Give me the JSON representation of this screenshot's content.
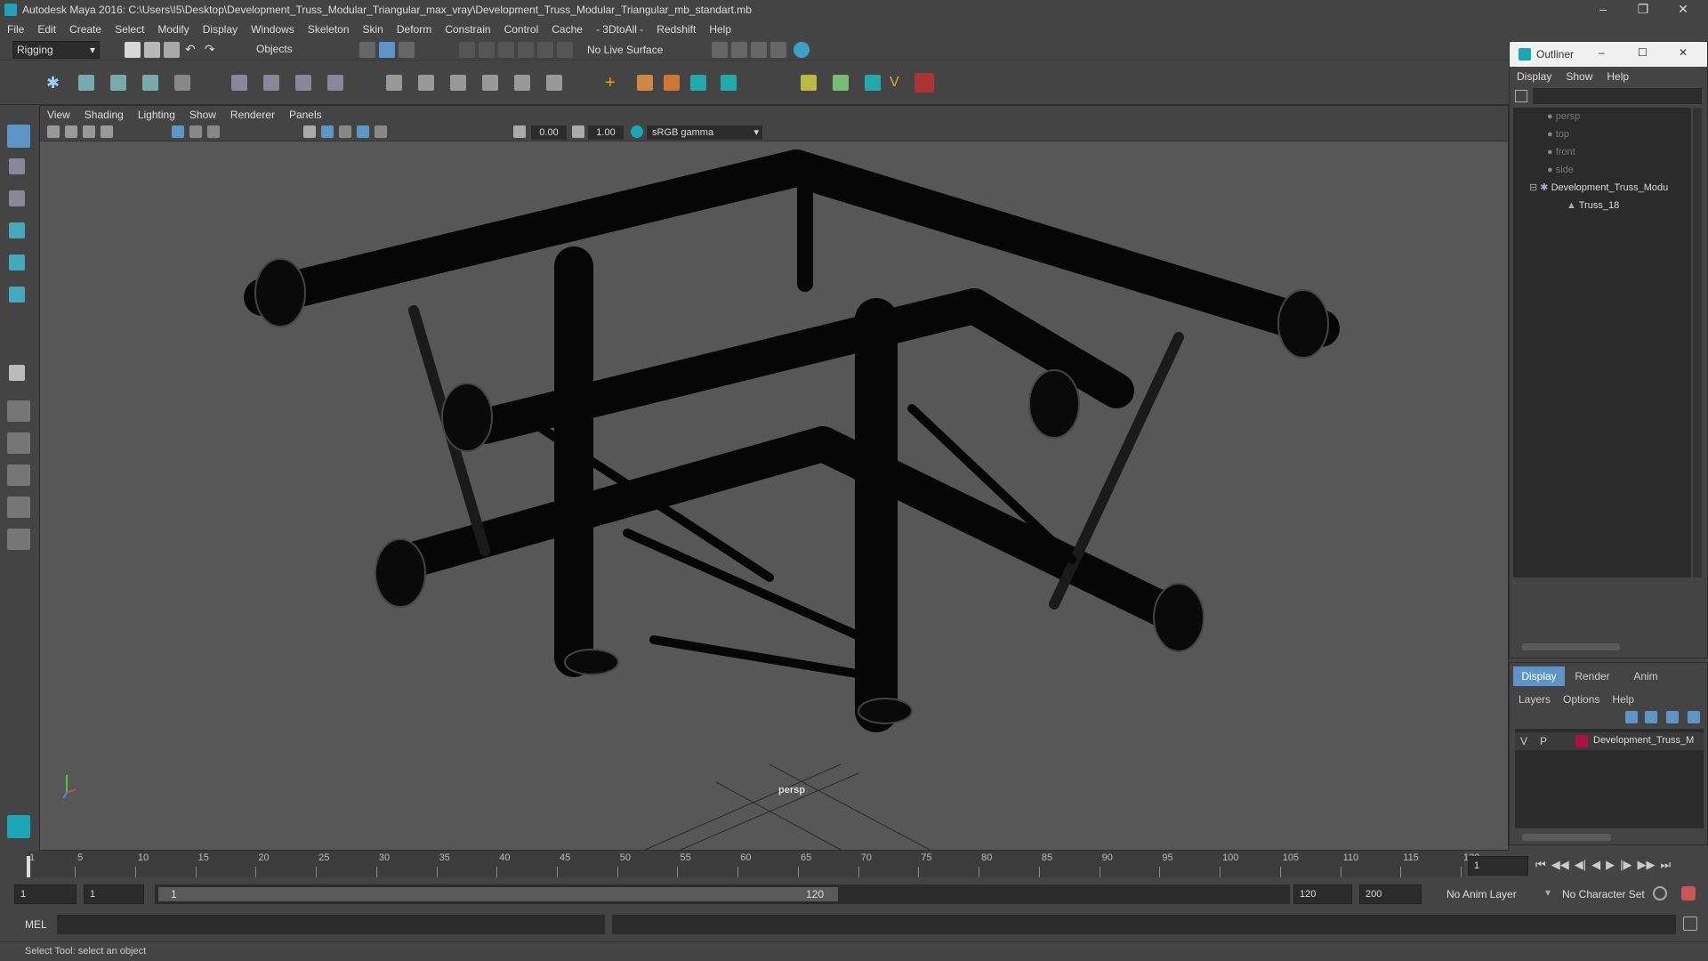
{
  "window": {
    "title": "Autodesk Maya 2016: C:\\Users\\I5\\Desktop\\Development_Truss_Modular_Triangular_max_vray\\Development_Truss_Modular_Triangular_mb_standart.mb"
  },
  "menubar": [
    "File",
    "Edit",
    "Create",
    "Select",
    "Modify",
    "Display",
    "Windows",
    "Skeleton",
    "Skin",
    "Deform",
    "Constrain",
    "Control",
    "Cache",
    "- 3DtoAll -",
    "Redshift",
    "Help"
  ],
  "toolbar": {
    "mode": "Rigging",
    "select_mode": "Objects",
    "live_surface": "No Live Surface"
  },
  "viewport": {
    "menu": [
      "View",
      "Shading",
      "Lighting",
      "Show",
      "Renderer",
      "Panels"
    ],
    "exposure": "0.00",
    "gamma": "1.00",
    "color_space": "sRGB gamma",
    "camera_label": "persp"
  },
  "outliner": {
    "title": "Outliner",
    "menu": [
      "Display",
      "Show",
      "Help"
    ],
    "items": [
      {
        "label": "persp",
        "icon": "camera-icon"
      },
      {
        "label": "top",
        "icon": "camera-icon"
      },
      {
        "label": "front",
        "icon": "camera-icon"
      },
      {
        "label": "side",
        "icon": "camera-icon"
      },
      {
        "label": "Development_Truss_Modu",
        "icon": "group-icon"
      },
      {
        "label": "Truss_18",
        "icon": "mesh-icon"
      }
    ]
  },
  "layer_editor": {
    "tabs": [
      "Display",
      "Render",
      "Anim"
    ],
    "menu": [
      "Layers",
      "Options",
      "Help"
    ],
    "layer": {
      "v": "V",
      "p": "P",
      "name": "Development_Truss_M",
      "color": "#b01040"
    }
  },
  "timeline": {
    "ticks": [
      "1",
      "5",
      "10",
      "15",
      "20",
      "25",
      "30",
      "35",
      "40",
      "45",
      "50",
      "55",
      "60",
      "65",
      "70",
      "75",
      "80",
      "85",
      "90",
      "95",
      "100",
      "105",
      "110",
      "115",
      "120"
    ],
    "current_frame": "1"
  },
  "range": {
    "start": "1",
    "start2": "1",
    "slider_start": "1",
    "slider_end": "120",
    "end": "120",
    "end2": "200",
    "anim_layer": "No Anim Layer",
    "char_set": "No Character Set"
  },
  "cmd": {
    "label": "MEL"
  },
  "help": {
    "text": "Select Tool: select an object"
  },
  "colors": {
    "accent": "#1aa6b7",
    "panel": "#444444",
    "viewport": "#575757",
    "field": "#2b2b2b"
  }
}
